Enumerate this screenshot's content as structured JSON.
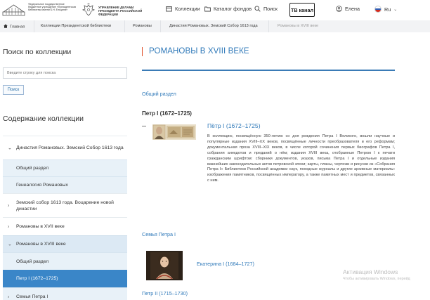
{
  "header": {
    "library_name": "Федеральное государственное бюджетное учреждение «Президентская библиотека имени Б.Н. Ельцина»",
    "admin_name": "УПРАВЛЕНИЕ ДЕЛАМИ ПРЕЗИДЕНТА РОССИЙСКОЙ ФЕДЕРАЦИИ",
    "nav": {
      "collections": "Коллекции",
      "catalog": "Каталог фондов",
      "search": "Поиск",
      "tv": "ТВ канал"
    },
    "user_name": "Елена",
    "language": "Ru",
    "colors": {
      "flag_white": "#ffffff",
      "flag_blue": "#2d5bb3",
      "flag_red": "#d52b1e"
    }
  },
  "breadcrumb": {
    "home": "Главная",
    "items": [
      "Коллекции Президентской библиотеки",
      "Романовы",
      "Династия Романовых. Земский Собор 1613 года",
      "Романовы в XVIII веке"
    ]
  },
  "sidebar": {
    "search_title": "Поиск по коллекции",
    "search_placeholder": "Введите строку для поиска",
    "search_button": "Поиск",
    "contents_title": "Содержание коллекции",
    "tree": [
      {
        "label": "Династия Романовых. Земский Собор 1613 года",
        "state": "expanded"
      },
      {
        "label": "Общий раздел",
        "state": "child"
      },
      {
        "label": "Генеалогия Романовых",
        "state": "child"
      },
      {
        "label": "Земский собор 1613 года. Воцарение новой династии",
        "state": "collapsed"
      },
      {
        "label": "Романовы в XVII веке",
        "state": "collapsed"
      },
      {
        "label": "Романовы в XVIII веке",
        "state": "expanded"
      },
      {
        "label": "Общий раздел",
        "state": "child"
      },
      {
        "label": "Петр I (1672–1725)",
        "state": "active"
      },
      {
        "label": "Семья Петра I",
        "state": "collapsed"
      }
    ],
    "colors": {
      "active": "#3a86c8",
      "child_bg": "#e8f1f8",
      "open_bg": "#dce9f4"
    }
  },
  "main": {
    "title": "РОМАНОВЫ В XVIII ВЕКЕ",
    "general_section": "Общий раздел",
    "peter_heading": "Петр I (1672–1725)",
    "entry": {
      "link": "Пётр I (1672–1725)",
      "description": "В коллекцию, посвящённую 350-летию со дня рождения Петра I Великого, вошли научные и популярные издания XVIII–XX веков, посвящённые личности преобразователя и его реформам; документальная проза XVIII–XIX веков, в числе которой сочинения первых биографов Петра I, собрания анекдотов и преданий о нём; издания XVIII века, отобранные Петром I к печати гражданским шрифтом: сборники документов, указов, письма Петра I и отдельные издания важнейших законодательных актов петровской эпохи; карты, планы, чертежи и рисунки из «Собрания Петра I» Библиотеки Российской академии наук, походные журналы и другие архивные материалы: изображения памятников, посвящённых императору, а также памятных мест и предметов, связанных с ним."
    },
    "family_section": "Семья Петра I",
    "catherine_link": "Екатерина I (1684–1727)",
    "peter2_link": "Петр II (1715–1730)",
    "colors": {
      "accent_blue": "#2f79b9",
      "title_marker": "#e0522c"
    }
  },
  "watermark": {
    "line1": "Активация Windows",
    "line2": "Чтобы активировать Windows, перейд"
  }
}
